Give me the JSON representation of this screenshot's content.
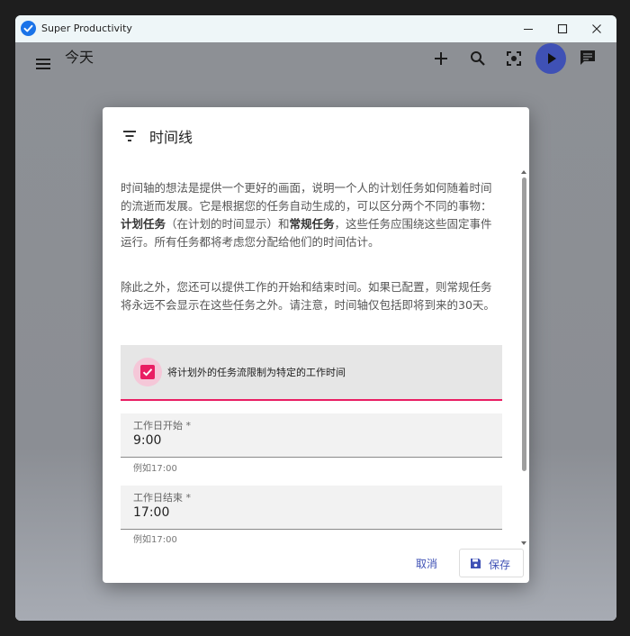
{
  "window": {
    "title": "Super Productivity"
  },
  "toolbar": {
    "page_title": "今天"
  },
  "dialog": {
    "title": "时间线",
    "paragraph1": {
      "t1": "时间轴的想法是提供一个更好的画面，说明一个人的计划任务如何随着时间的流逝而发展。它是根据您的任务自动生成的，可以区分两个不同的事物：",
      "b1": "计划任务",
      "t2": "（在计划的时间显示）和",
      "b2": "常规任务",
      "t3": "，这些任务应围绕这些固定事件运行。所有任务都将考虑您分配给他们的时间估计。"
    },
    "paragraph2": "除此之外，您还可以提供工作的开始和结束时间。如果已配置，则常规任务将永远不会显示在这些任务之外。请注意，时间轴仅包括即将到来的30天。",
    "checkbox": {
      "label": "将计划外的任务流限制为特定的工作时间",
      "checked": true
    },
    "work_start": {
      "label": "工作日开始 *",
      "value": "9:00",
      "hint": "例如17:00"
    },
    "work_end": {
      "label": "工作日结束 *",
      "value": "17:00",
      "hint": "例如17:00"
    },
    "cancel_label": "取消",
    "save_label": "保存"
  },
  "colors": {
    "accent": "#e91e63",
    "primary": "#3f51b5",
    "app_blue": "#1a73e8"
  },
  "icons": [
    "check-circle-icon",
    "minimize-icon",
    "maximize-icon",
    "close-icon",
    "menu-icon",
    "add-icon",
    "search-icon",
    "focus-icon",
    "play-icon",
    "comment-icon",
    "filter-list-icon",
    "checkmark-icon",
    "save-icon"
  ]
}
